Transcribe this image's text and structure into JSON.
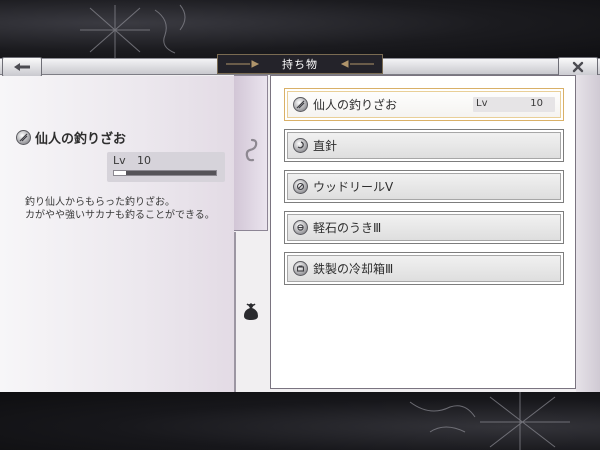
{
  "header": {
    "title": "持ち物",
    "back_icon": "back-arrow-icon",
    "close_icon": "close-x-icon"
  },
  "detail": {
    "name": "仙人の釣りざお",
    "lv_label": "Lv",
    "lv_value": "10",
    "progress": 0.12,
    "description": "釣り仙人からもらった釣りざお。\nカがやや強いサカナも釣ることができる。"
  },
  "items": [
    {
      "name": "仙人の釣りざお",
      "icon": "fishing-rod-icon",
      "selected": true,
      "lv_label": "Lv",
      "lv_value": "10"
    },
    {
      "name": "直針",
      "icon": "hook-icon",
      "selected": false
    },
    {
      "name": "ウッドリールⅤ",
      "icon": "reel-icon",
      "selected": false
    },
    {
      "name": "軽石のうきⅢ",
      "icon": "float-icon",
      "selected": false
    },
    {
      "name": "鉄製の冷却箱Ⅲ",
      "icon": "cooler-box-icon",
      "selected": false
    }
  ],
  "colors": {
    "selected_border": "#d9b067",
    "title_bg": "#24232a"
  }
}
